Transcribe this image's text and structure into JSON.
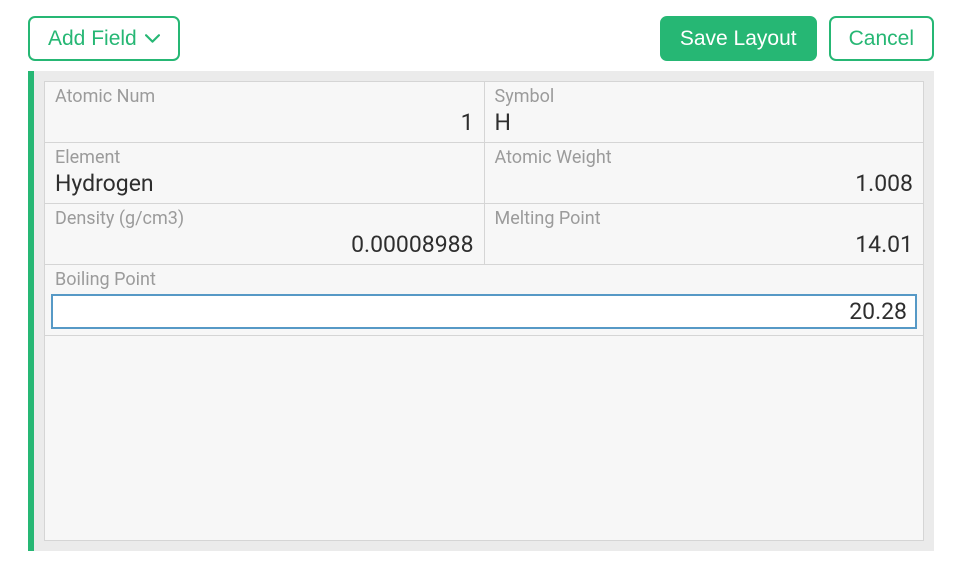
{
  "toolbar": {
    "add_field_label": "Add Field",
    "save_label": "Save Layout",
    "cancel_label": "Cancel"
  },
  "fields": {
    "atomic_num": {
      "label": "Atomic Num",
      "value": "1"
    },
    "symbol": {
      "label": "Symbol",
      "value": "H"
    },
    "element": {
      "label": "Element",
      "value": "Hydrogen"
    },
    "atomic_weight": {
      "label": "Atomic Weight",
      "value": "1.008"
    },
    "density": {
      "label": "Density (g/cm3)",
      "value": "0.00008988"
    },
    "melting_point": {
      "label": "Melting Point",
      "value": "14.01"
    },
    "boiling_point": {
      "label": "Boiling Point",
      "value": "20.28"
    }
  },
  "colors": {
    "accent": "#26b774",
    "selection_border": "#5699c6"
  }
}
